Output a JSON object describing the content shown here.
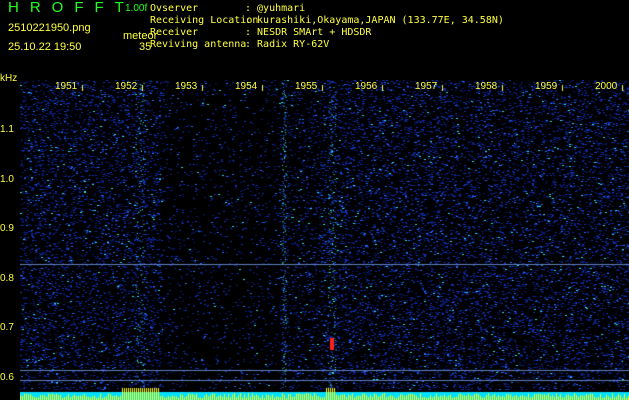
{
  "header": {
    "title": "HROFFT",
    "version": "1.00f",
    "filename": "2510221950.png",
    "datetime": "25.10.22 19:50",
    "meteor_label": "meteor",
    "meteor_count": "35"
  },
  "info": [
    {
      "label": "Ovserver",
      "value": ": @yuhmari"
    },
    {
      "label": "Receiving Location",
      "value": ": kurashiki,Okayama,JAPAN (133.77E, 34.58N)"
    },
    {
      "label": "Receiver",
      "value": ": NESDR SMArt + HDSDR"
    },
    {
      "label": "Reviving antenna",
      "value": ": Radix RY-62V"
    }
  ],
  "axis": {
    "unit": "kHz",
    "y_ticks": [
      "1.1",
      "1.0",
      "0.9",
      "0.8",
      "0.7",
      "0.6"
    ],
    "x_ticks": [
      "1951",
      "1952",
      "1953",
      "1954",
      "1955",
      "1956",
      "1957",
      "1958",
      "1959",
      "2000"
    ]
  },
  "colors": {
    "text": "#ffff40",
    "title": "#20ff20",
    "noise": "#1030c0"
  }
}
